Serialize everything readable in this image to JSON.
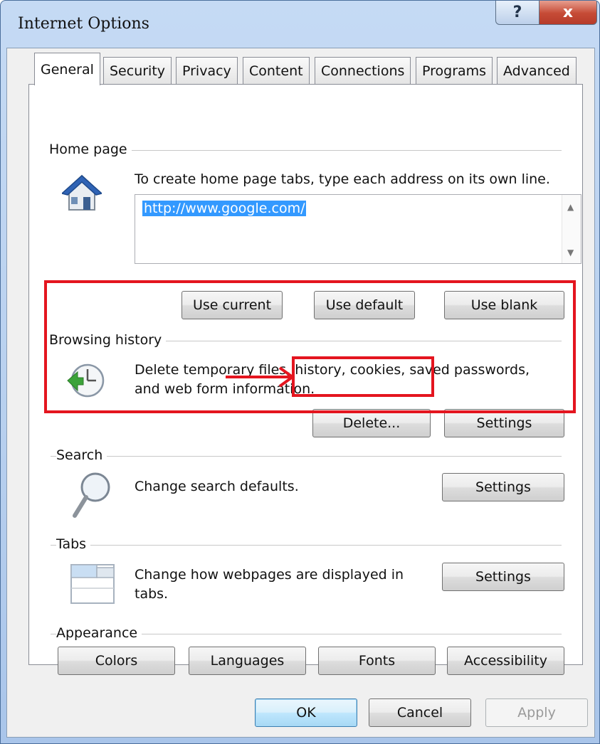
{
  "window": {
    "title": "Internet Options",
    "help_glyph": "?",
    "close_glyph": "x"
  },
  "tabs": [
    {
      "label": "General",
      "active": true
    },
    {
      "label": "Security"
    },
    {
      "label": "Privacy"
    },
    {
      "label": "Content"
    },
    {
      "label": "Connections"
    },
    {
      "label": "Programs"
    },
    {
      "label": "Advanced"
    }
  ],
  "home_page": {
    "group_label": "Home page",
    "description": "To create home page tabs, type each address on its own line.",
    "url_value": "http://www.google.com/",
    "use_current": "Use current",
    "use_default": "Use default",
    "use_blank": "Use blank"
  },
  "browsing_history": {
    "group_label": "Browsing history",
    "description_line1": "Delete temporary files, history, cookies, saved passwords,",
    "description_line2": "and web form information.",
    "delete_button": "Delete...",
    "settings_button": "Settings"
  },
  "search": {
    "group_label": "Search",
    "description": "Change search defaults.",
    "settings_button": "Settings"
  },
  "tabs_group": {
    "group_label": "Tabs",
    "description_line1": "Change how webpages are displayed in",
    "description_line2": "tabs.",
    "settings_button": "Settings"
  },
  "appearance": {
    "group_label": "Appearance",
    "colors": "Colors",
    "languages": "Languages",
    "fonts": "Fonts",
    "accessibility": "Accessibility"
  },
  "footer": {
    "ok": "OK",
    "cancel": "Cancel",
    "apply": "Apply"
  },
  "colors": {
    "highlight": "#e4151f",
    "selection": "#3399ff",
    "close_red": "#c64b36"
  }
}
